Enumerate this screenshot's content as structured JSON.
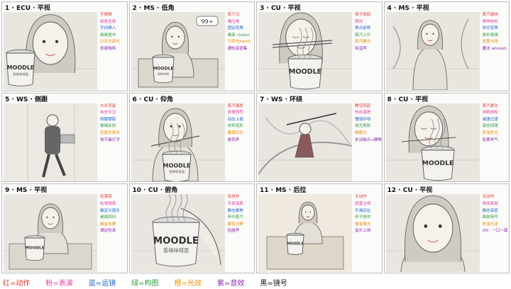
{
  "colors": {
    "red": "#e53935",
    "pink": "#e040a0",
    "blue": "#1e63c8",
    "green": "#2e9b3e",
    "orange": "#f08c00",
    "purple": "#8e24aa",
    "black": "#111111"
  },
  "panels": [
    {
      "title": "1 · ECU · 平视",
      "product_label": "MOODLE",
      "product_sub": "香辣味噌面",
      "notes": [
        {
          "text": "手微颤",
          "color": "red"
        },
        {
          "text": "疲惫至极",
          "color": "pink"
        },
        {
          "text": "手持推入",
          "color": "blue"
        },
        {
          "text": "画面居中",
          "color": "green"
        },
        {
          "text": "冷灰光源光",
          "color": "orange"
        },
        {
          "text": "低频嗡鸣",
          "color": "purple"
        }
      ]
    },
    {
      "title": "2 · MS · 低角",
      "product_label": "MOODLE",
      "product_sub": "香辣味噌面",
      "bubble": "99+",
      "notes": [
        {
          "text": "肩下沉",
          "color": "red"
        },
        {
          "text": "嘴压角",
          "color": "pink"
        },
        {
          "text": "固定低角",
          "color": "blue"
        },
        {
          "text": "桌面 clutter",
          "color": "green"
        },
        {
          "text": "冷荧光harsh",
          "color": "orange"
        },
        {
          "text": "通知音密集",
          "color": "purple"
        }
      ]
    },
    {
      "title": "3 · CU · 平视",
      "product_label": "MOODLE",
      "notes": [
        {
          "text": "筷子提起",
          "color": "red"
        },
        {
          "text": "期待",
          "color": "pink"
        },
        {
          "text": "焦点前移",
          "color": "blue"
        },
        {
          "text": "蒸汽上升",
          "color": "green"
        },
        {
          "text": "蒸汽暖光",
          "color": "orange"
        },
        {
          "text": "吸溜声",
          "color": "purple"
        }
      ]
    },
    {
      "title": "4 · MS · 平视",
      "notes": [
        {
          "text": "蒸汽缠绕",
          "color": "red"
        },
        {
          "text": "眼神放松",
          "color": "pink"
        },
        {
          "text": "快切变焦",
          "color": "blue"
        },
        {
          "text": "身形极强",
          "color": "green"
        },
        {
          "text": "轻盈光线",
          "color": "orange"
        },
        {
          "text": "魔法 whoosh",
          "color": "purple"
        }
      ]
    },
    {
      "title": "5 · WS · 侧跟",
      "notes": [
        {
          "text": "大步流星",
          "color": "red"
        },
        {
          "text": "自信专注",
          "color": "pink"
        },
        {
          "text": "侧跟跟踪",
          "color": "blue"
        },
        {
          "text": "玻璃反射",
          "color": "green"
        },
        {
          "text": "轻盈环境光",
          "color": "orange"
        },
        {
          "text": "快节奏打字",
          "color": "purple"
        }
      ]
    },
    {
      "title": "6 · CU · 仰角",
      "product_label": "MOODLE",
      "product_sub": "香辣味噌面",
      "notes": [
        {
          "text": "蒸汽爆发",
          "color": "red"
        },
        {
          "text": "表情转烈",
          "color": "pink"
        },
        {
          "text": "动态上摇",
          "color": "blue"
        },
        {
          "text": "衣料变形",
          "color": "green"
        },
        {
          "text": "暮霭红光",
          "color": "orange"
        },
        {
          "text": "拔剑声",
          "color": "purple"
        }
      ]
    },
    {
      "title": "7 · WS · 环绕",
      "notes": [
        {
          "text": "腾空跃起",
          "color": "red"
        },
        {
          "text": "热血激昂",
          "color": "pink"
        },
        {
          "text": "慢镜环绕",
          "color": "blue"
        },
        {
          "text": "逆光剪影",
          "color": "green"
        },
        {
          "text": "暖霞光",
          "color": "orange"
        },
        {
          "text": "史诗鼓点→静默",
          "color": "purple"
        }
      ]
    },
    {
      "title": "8 · CU · 平视",
      "product_label": "MOODLE",
      "notes": [
        {
          "text": "蒸汽柔化",
          "color": "red"
        },
        {
          "text": "闭眼放松",
          "color": "pink"
        },
        {
          "text": "减速过渡",
          "color": "blue"
        },
        {
          "text": "姿态回落",
          "color": "green"
        },
        {
          "text": "奶油色光",
          "color": "orange"
        },
        {
          "text": "轻柔呼气",
          "color": "purple"
        }
      ]
    },
    {
      "title": "9 · MS · 平视",
      "product_label": "MOODLE",
      "notes": [
        {
          "text": "轻落座",
          "color": "red"
        },
        {
          "text": "松弛微笑",
          "color": "pink"
        },
        {
          "text": "稳定长镜头",
          "color": "blue"
        },
        {
          "text": "桌面回归",
          "color": "green"
        },
        {
          "text": "暖金包裹",
          "color": "orange"
        },
        {
          "text": "满足叹息",
          "color": "purple"
        }
      ]
    },
    {
      "title": "10 · CU · 俯角",
      "product_label": "MOODLE",
      "product_sub": "香辣味噌面",
      "notes": [
        {
          "text": "轻放杯",
          "color": "red"
        },
        {
          "text": "手部温柔",
          "color": "pink"
        },
        {
          "text": "静态聚焦",
          "color": "blue"
        },
        {
          "text": "杯中蒸汽",
          "color": "green"
        },
        {
          "text": "暖色光晕",
          "color": "orange"
        },
        {
          "text": "轻碰声",
          "color": "purple"
        }
      ]
    },
    {
      "title": "11 · MS · 后拉",
      "product_label": "MOODLE",
      "notes": [
        {
          "text": "无动作",
          "color": "red"
        },
        {
          "text": "感重注视",
          "color": "pink"
        },
        {
          "text": "平滑后拉",
          "color": "blue"
        },
        {
          "text": "杯子居中",
          "color": "green"
        },
        {
          "text": "暖金聚光",
          "color": "orange"
        },
        {
          "text": "音乐上扬",
          "color": "purple"
        }
      ]
    },
    {
      "title": "12 · CU · 平视",
      "notes": [
        {
          "text": "无动作",
          "color": "red"
        },
        {
          "text": "明亮笑容",
          "color": "pink"
        },
        {
          "text": "静态亲密",
          "color": "blue"
        },
        {
          "text": "面部特写",
          "color": "green"
        },
        {
          "text": "奶油光泽",
          "color": "orange"
        },
        {
          "text": "VO：一口一面 千面最爱",
          "color": "purple"
        }
      ]
    }
  ],
  "legend": [
    {
      "text": "红=动作",
      "color": "red"
    },
    {
      "text": "粉=表演",
      "color": "pink"
    },
    {
      "text": "蓝=运镜",
      "color": "blue"
    },
    {
      "text": "绿=构图",
      "color": "green"
    },
    {
      "text": "橙=光效",
      "color": "orange"
    },
    {
      "text": "紫=音效",
      "color": "purple"
    },
    {
      "text": "黑=镜号",
      "color": "black"
    }
  ]
}
